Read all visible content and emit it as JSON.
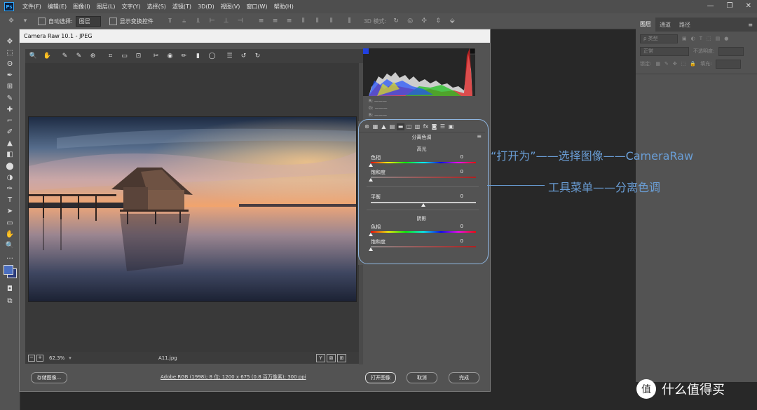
{
  "menubar": {
    "logo": "Ps",
    "items": [
      "文件(F)",
      "编辑(E)",
      "图像(I)",
      "图层(L)",
      "文字(Y)",
      "选择(S)",
      "滤镜(T)",
      "3D(D)",
      "视图(V)",
      "窗口(W)",
      "帮助(H)"
    ],
    "window_controls": [
      "—",
      "❐",
      "✕"
    ]
  },
  "options": {
    "auto_select_label": "自动选择:",
    "auto_select_value": "图层",
    "show_transform_label": "显示变换控件",
    "mode_3d_label": "3D 模式:"
  },
  "tools": [
    "✥",
    "⬚",
    "ʘ",
    "✒",
    "⊞",
    "✎",
    "✚",
    "⌐",
    "✐",
    "▲",
    "◧",
    "⬤",
    "◑",
    "✑",
    "T",
    "➤",
    "▭",
    "✋",
    "🔍",
    "…"
  ],
  "right_panel": {
    "tabs": [
      "图层",
      "通道",
      "路径"
    ],
    "kind_label": "ρ 类型",
    "blend_mode": "正常",
    "opacity_label": "不透明度:",
    "lock_label": "锁定:",
    "fill_label": "填充:"
  },
  "camera_raw": {
    "title": "Camera Raw 10.1  -  JPEG",
    "toolbar_icons": [
      "🔍",
      "✋",
      "✎",
      "✎",
      "⊕",
      "⌗",
      "▭",
      "⊡",
      "✂",
      "◉",
      "✏",
      "▮",
      "◯",
      "☰",
      "↺",
      "↻"
    ],
    "zoom_label": "62.3%",
    "filename": "A11.jpg",
    "view_buttons": [
      "Y",
      "⊠",
      "⊞"
    ],
    "rgb_readout": [
      "R:  ———",
      "G:  ———",
      "B:  ———"
    ],
    "panel_icons": [
      "⊛",
      "▦",
      "▲",
      "▤",
      "▬",
      "◫",
      "▥",
      "fx",
      "◙",
      "☰",
      "▣"
    ],
    "panel_title": "分离色调",
    "sections": {
      "highlights": "高光",
      "balance": "平衡",
      "shadows": "阴影"
    },
    "sliders": [
      {
        "label": "色相",
        "value": "0",
        "type": "hue",
        "pos": 0.0
      },
      {
        "label": "饱和度",
        "value": "0",
        "type": "sat",
        "pos": 0.0
      },
      {
        "label": "平衡",
        "value": "0",
        "type": "bal",
        "pos": 0.5
      },
      {
        "label": "色相",
        "value": "0",
        "type": "hue",
        "pos": 0.0
      },
      {
        "label": "饱和度",
        "value": "0",
        "type": "sat",
        "pos": 0.0
      }
    ],
    "footer": {
      "save_image": "存储图像...",
      "workflow": "Adobe RGB (1998); 8 位; 1200 x 675 (0.8 百万像素); 300 ppi",
      "open_image": "打开图像",
      "cancel": "取消",
      "done": "完成"
    }
  },
  "annotations": {
    "line1": "“打开为”——选择图像——CameraRaw",
    "line2": "工具菜单——分离色调",
    "accent_color": "#6a9ed6"
  },
  "watermark": {
    "logo": "值",
    "text": "什么值得买"
  }
}
